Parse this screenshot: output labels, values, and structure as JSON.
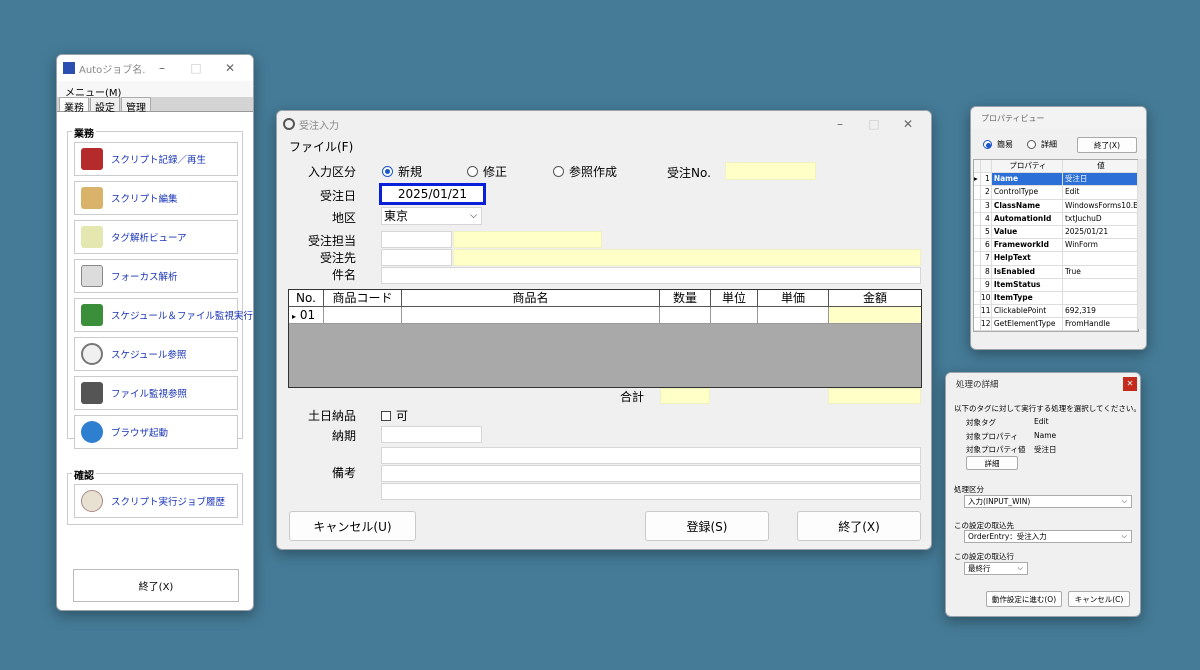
{
  "left": {
    "title": "Autoジョブ名...",
    "menu": "メニュー(M)",
    "tabs": [
      "業務",
      "設定",
      "管理"
    ],
    "group1_label": "業務",
    "buttons": [
      "スクリプト記録／再生",
      "スクリプト編集",
      "タグ解析ビューア",
      "フォーカス解析",
      "スケジュール＆ファイル監視実行",
      "スケジュール参照",
      "ファイル監視参照",
      "ブラウザ起動"
    ],
    "group2_label": "確認",
    "history_button": "スクリプト実行ジョブ履歴",
    "exit_button": "終了(X)"
  },
  "main": {
    "title": "受注入力",
    "menu": "ファイル(F)",
    "input_kbn_label": "入力区分",
    "radios": [
      "新規",
      "修正",
      "参照作成"
    ],
    "selected_radio": "新規",
    "order_no_label": "受注No.",
    "order_date_label": "受注日",
    "order_date_value": "2025/01/21",
    "region_label": "地区",
    "region_value": "東京",
    "person_label": "受注担当",
    "customer_label": "受注先",
    "subject_label": "件名",
    "grid": {
      "columns": [
        "No.",
        "商品コード",
        "商品名",
        "数量",
        "単位",
        "単価",
        "金額"
      ],
      "row_no": "01",
      "row_marker": "▸"
    },
    "total_label": "合計",
    "weekend_label": "土日納品",
    "weekend_checkbox": "可",
    "deadline_label": "納期",
    "memo_label": "備考",
    "cancel_button": "キャンセル(U)",
    "register_button": "登録(S)",
    "exit_button": "終了(X)"
  },
  "prop": {
    "title": "プロパティビュー",
    "radio_simple": "簡易",
    "radio_detail": "詳細",
    "exit_button": "終了(X)",
    "col_prop": "プロパティ",
    "col_val": "値",
    "rows": [
      {
        "n": "1",
        "p": "Name",
        "v": "受注日",
        "bold": true
      },
      {
        "n": "2",
        "p": "ControlType",
        "v": "Edit",
        "bold": false
      },
      {
        "n": "3",
        "p": "ClassName",
        "v": "WindowsForms10.EDI...",
        "bold": true
      },
      {
        "n": "4",
        "p": "AutomationId",
        "v": "txtJuchuD",
        "bold": true
      },
      {
        "n": "5",
        "p": "Value",
        "v": "2025/01/21",
        "bold": true
      },
      {
        "n": "6",
        "p": "FrameworkId",
        "v": "WinForm",
        "bold": true
      },
      {
        "n": "7",
        "p": "HelpText",
        "v": "",
        "bold": true
      },
      {
        "n": "8",
        "p": "IsEnabled",
        "v": "True",
        "bold": true
      },
      {
        "n": "9",
        "p": "ItemStatus",
        "v": "",
        "bold": true
      },
      {
        "n": "10",
        "p": "ItemType",
        "v": "",
        "bold": true
      },
      {
        "n": "11",
        "p": "ClickablePoint",
        "v": "692,319",
        "bold": false
      },
      {
        "n": "12",
        "p": "GetElementType",
        "v": "FromHandle",
        "bold": false
      }
    ]
  },
  "detail": {
    "title": "処理の詳細",
    "instruction": "以下のタグに対して実行する処理を選択してください。",
    "tag_label": "対象タグ",
    "tag_value": "Edit",
    "prop_label": "対象プロパティ",
    "prop_value": "Name",
    "propval_label": "対象プロパティ値",
    "propval_value": "受注日",
    "detail_button": "詳細",
    "kbn_label": "処理区分",
    "kbn_value": "入力(INPUT_WIN)",
    "dest_label": "この設定の取込先",
    "dest_value": "OrderEntry：受注入力",
    "line_label": "この設定の取込行",
    "line_value": "最終行",
    "go_button": "動作設定に進む(O)",
    "cancel_button": "キャンセル(C)"
  }
}
